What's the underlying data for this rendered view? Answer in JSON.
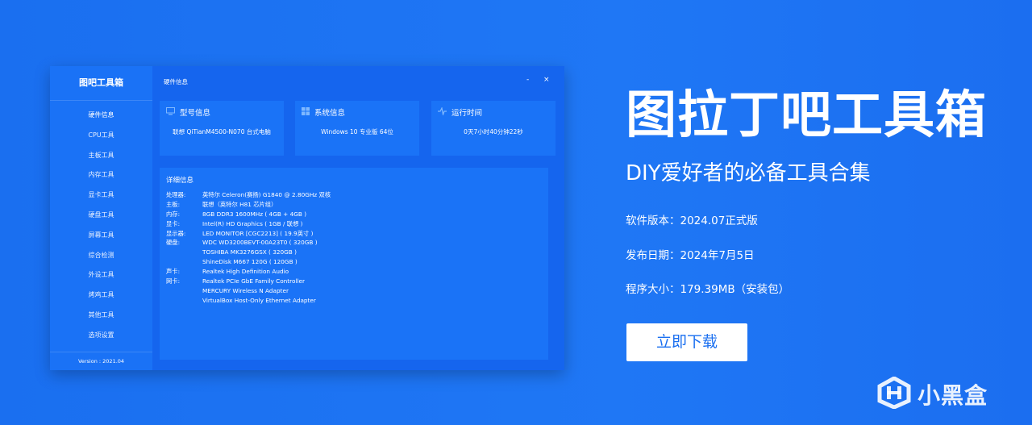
{
  "app": {
    "title": "图吧工具箱",
    "version": "Version : 2021.04",
    "window_title": "硬件信息",
    "minimize": "-",
    "close": "×"
  },
  "sidebar": {
    "items": [
      {
        "label": "硬件信息"
      },
      {
        "label": "CPU工具"
      },
      {
        "label": "主板工具"
      },
      {
        "label": "内存工具"
      },
      {
        "label": "显卡工具"
      },
      {
        "label": "硬盘工具"
      },
      {
        "label": "屏幕工具"
      },
      {
        "label": "综合检测"
      },
      {
        "label": "外设工具"
      },
      {
        "label": "烤鸡工具"
      },
      {
        "label": "其他工具"
      },
      {
        "label": "选项设置"
      }
    ]
  },
  "cards": [
    {
      "icon": "monitor-icon",
      "title": "型号信息",
      "value": "联想 QiTianM4500-N070 台式电脑"
    },
    {
      "icon": "windows-icon",
      "title": "系统信息",
      "value": "Windows 10 专业版 64位"
    },
    {
      "icon": "activity-icon",
      "title": "运行时间",
      "value": "0天7小时40分钟22秒"
    }
  ],
  "detail": {
    "title": "详细信息",
    "rows": [
      {
        "k": "处理器:",
        "v": "英特尔 Celeron(赛扬) G1840 @ 2.80GHz 双核"
      },
      {
        "k": "主板:",
        "v": "联想（英特尔 H81 芯片组）"
      },
      {
        "k": "内存:",
        "v": "8GB DDR3 1600MHz ( 4GB + 4GB )"
      },
      {
        "k": "显卡:",
        "v": "Intel(R) HD Graphics ( 1GB / 联想 )"
      },
      {
        "k": "显示器:",
        "v": "LED MONITOR [CGC2213] ( 19.9英寸 )"
      },
      {
        "k": "硬盘:",
        "v": "WDC WD3200BEVT-00A23T0 ( 320GB )"
      },
      {
        "k": "",
        "v": "TOSHIBA MK3276GSX ( 320GB )"
      },
      {
        "k": "",
        "v": "ShineDisk M667 120G ( 120GB )"
      },
      {
        "k": "声卡:",
        "v": "Realtek High Definition Audio"
      },
      {
        "k": "网卡:",
        "v": "Realtek PCIe GbE Family Controller"
      },
      {
        "k": "",
        "v": "MERCURY Wireless N Adapter"
      },
      {
        "k": "",
        "v": "VirtualBox Host-Only Ethernet Adapter"
      }
    ]
  },
  "promo": {
    "title": "图拉丁吧工具箱",
    "subtitle": "DIY爱好者的必备工具合集",
    "version": "软件版本：2024.07正式版",
    "date": "发布日期：2024年7月5日",
    "size": "程序大小：179.39MB（安装包）",
    "download": "立即下载"
  },
  "watermark": {
    "text": "小黑盒"
  },
  "colors": {
    "background": "#1a6ff0",
    "window": "#1565ee",
    "panel": "#1a73f7",
    "button_text": "#1a6ff0"
  }
}
